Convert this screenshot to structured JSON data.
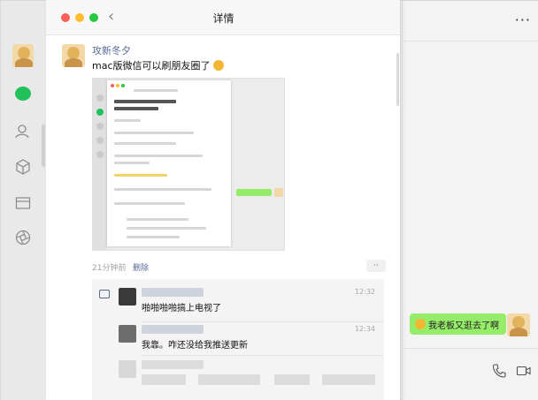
{
  "detail": {
    "title": "详情",
    "back_glyph": "‹",
    "post": {
      "author": "攻新冬夕",
      "text": "mac版微信可以刷朋友圈了",
      "time": "21分钟前",
      "delete_label": "删除",
      "more_label": "··"
    },
    "comments": [
      {
        "time": "12:32",
        "text": "啪啪啪啪搞上电视了"
      },
      {
        "time": "12:34",
        "text": "我靠。咋还没给我推送更新"
      }
    ]
  },
  "chat": {
    "more_label": "···",
    "bubble_text": "我老板又逛去了啊"
  },
  "icons": {
    "rail": [
      "avatar",
      "chat-icon",
      "contacts-icon",
      "moments-icon",
      "folder-icon",
      "settings-icon"
    ],
    "right": [
      "phone-icon",
      "video-icon"
    ]
  },
  "colors": {
    "wechat_green": "#22c15a",
    "bubble_green": "#95ec69",
    "link_blue": "#576b95"
  }
}
